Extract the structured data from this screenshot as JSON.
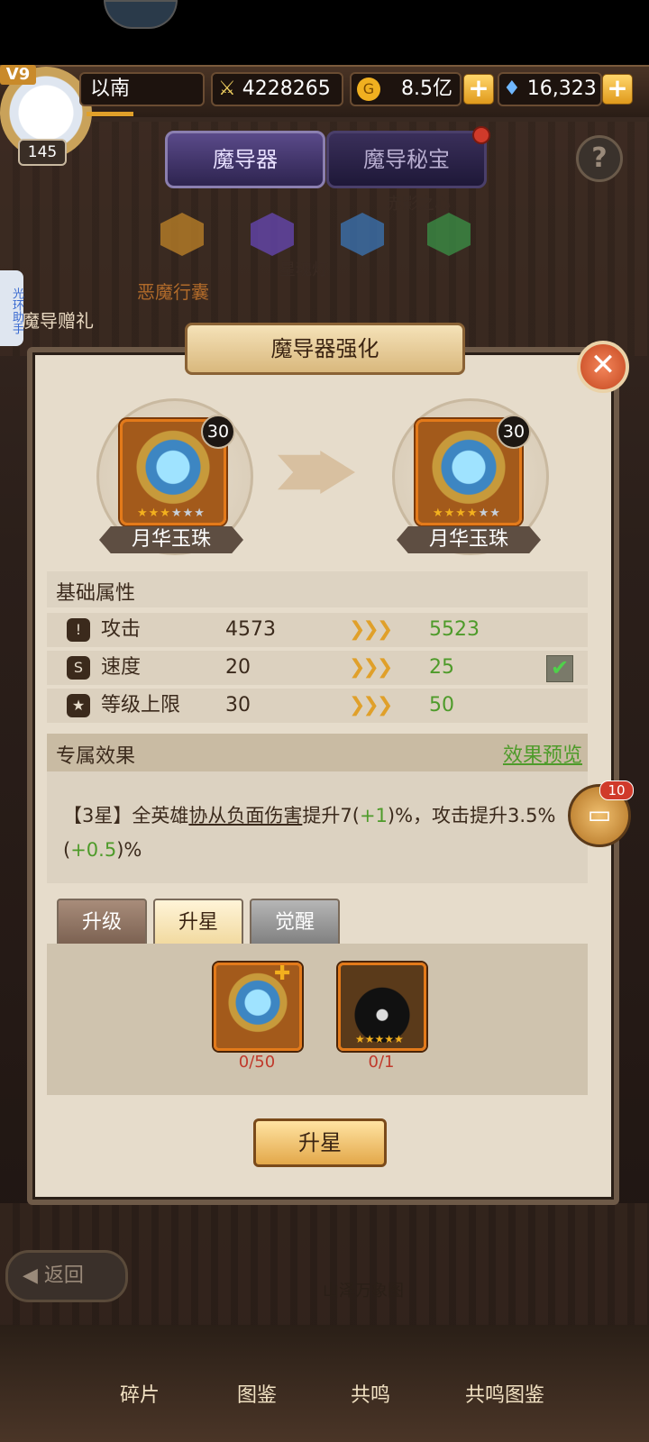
{
  "player": {
    "vip": "V9",
    "name": "以南",
    "level": "145"
  },
  "currency": {
    "power": "4228265",
    "gold": "8.5亿",
    "gems": "16,323"
  },
  "tabs": [
    "魔导器",
    "魔导秘宝"
  ],
  "bg": {
    "item_label_top": "赤影之心",
    "lamp_label": "星魂灯",
    "bag_label": "恶魔行囊",
    "gift_label": "魔导赠礼",
    "assist_label": "光环助手",
    "scroll_label": "山泽万象图"
  },
  "dialog": {
    "title": "魔导器强化",
    "before": {
      "name": "月华玉珠",
      "level": "30",
      "stars_filled": 3,
      "stars_total": 6
    },
    "after": {
      "name": "月华玉珠",
      "level": "30",
      "stars_filled": 4,
      "stars_total": 6
    },
    "base_title": "基础属性",
    "attributes": [
      {
        "label": "攻击",
        "from": "4573",
        "to": "5523",
        "checked": false
      },
      {
        "label": "速度",
        "from": "20",
        "to": "25",
        "checked": true
      },
      {
        "label": "等级上限",
        "from": "30",
        "to": "50",
        "checked": false
      }
    ],
    "exclusive_title": "专属效果",
    "preview_link": "效果预览",
    "effect": {
      "p1": "【3星】全英雄",
      "p2": "协从负面伤害",
      "p3": "提升7(",
      "p4": "+1",
      "p5": ")%，攻击提升3.5%(",
      "p6": "+0.5",
      "p7": ")%"
    },
    "tabs": [
      "升级",
      "升星",
      "觉醒"
    ],
    "materials": [
      {
        "count": "0/50"
      },
      {
        "count": "0/1"
      }
    ],
    "action": "升星"
  },
  "chat_badge": "10",
  "back_label": "返回",
  "nav": [
    "碎片",
    "图鉴",
    "共鸣",
    "共鸣图鉴"
  ]
}
